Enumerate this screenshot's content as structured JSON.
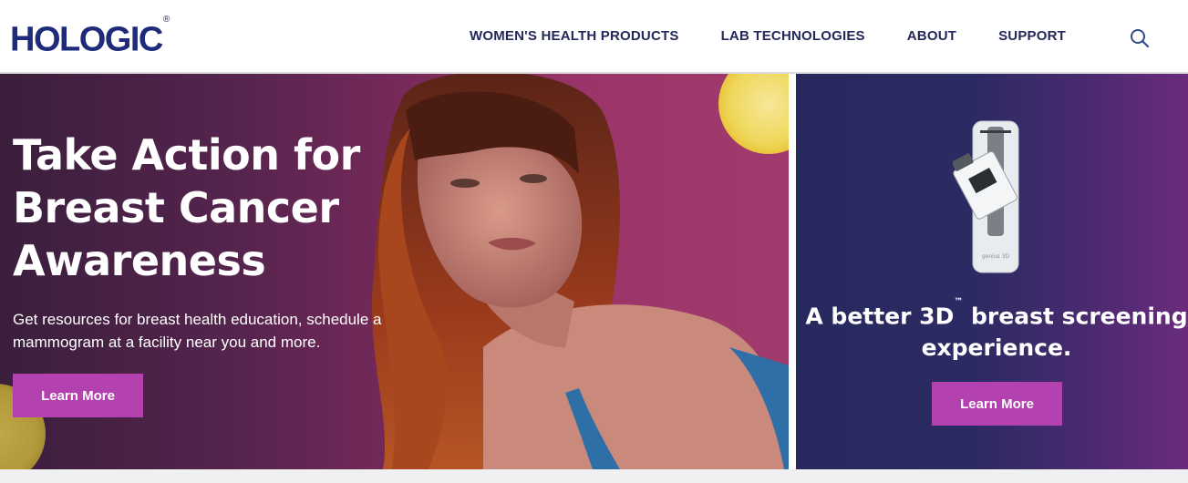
{
  "header": {
    "logo_text": "HOLOGIC",
    "logo_mark": "®",
    "nav": [
      {
        "label": "WOMEN'S HEALTH PRODUCTS"
      },
      {
        "label": "LAB TECHNOLOGIES"
      },
      {
        "label": "ABOUT"
      },
      {
        "label": "SUPPORT"
      }
    ],
    "search_icon": "search-icon"
  },
  "hero_left": {
    "title": "Take Action for Breast Cancer Awareness",
    "text": "Get resources for breast health education, schedule a mammogram at a facility near you and more.",
    "button_label": "Learn More"
  },
  "hero_right": {
    "title_part1": "A better 3D",
    "title_tm": "™",
    "title_part2": " breast screening experience.",
    "button_label": "Learn More",
    "device_label": "genius 3D"
  },
  "colors": {
    "brand_navy": "#1f2b7a",
    "button_purple": "#b441b0",
    "nav_text": "#25285a"
  }
}
